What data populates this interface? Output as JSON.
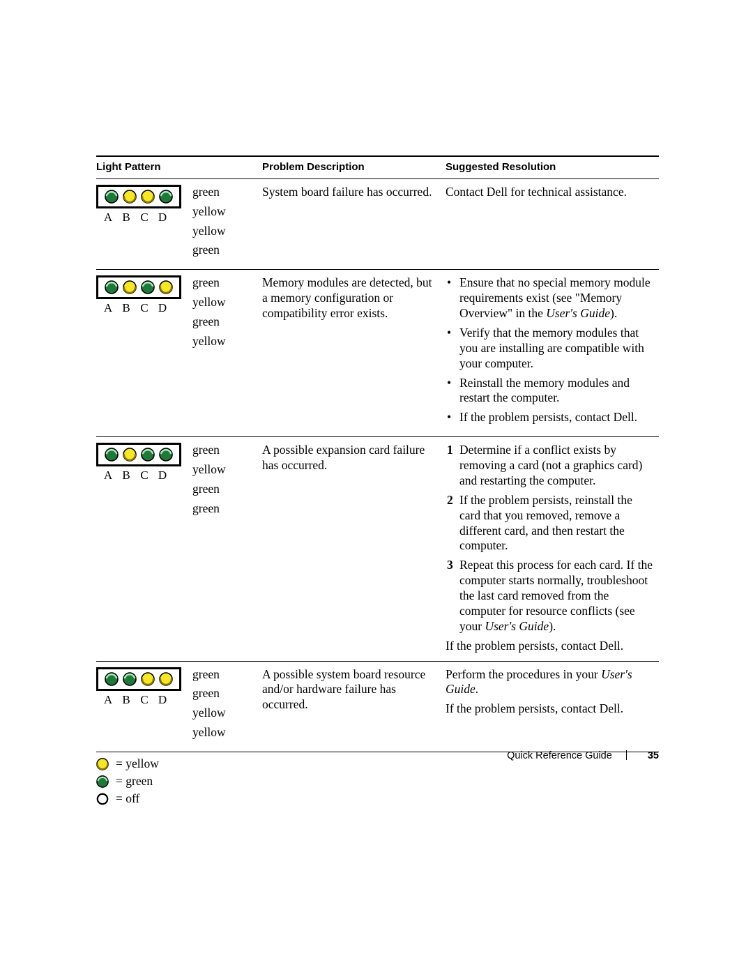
{
  "headers": {
    "light_pattern": "Light Pattern",
    "problem": "Problem Description",
    "resolution": "Suggested Resolution"
  },
  "led_labels": [
    "A",
    "B",
    "C",
    "D"
  ],
  "colors": {
    "yellow_fill": "#f6e72a",
    "yellow_stroke": "#8a7a00",
    "green_fill": "#1f7a3a",
    "green_stroke": "#0e4a22",
    "green_high": "#a6e6b8",
    "off_stroke": "#000000"
  },
  "rows": [
    {
      "leds": [
        "green",
        "yellow",
        "yellow",
        "green"
      ],
      "codes": [
        "green",
        "yellow",
        "yellow",
        "green"
      ],
      "problem": "System board failure has occurred.",
      "resolution_plain": "Contact Dell for technical assistance."
    },
    {
      "leds": [
        "green",
        "yellow",
        "green",
        "yellow"
      ],
      "codes": [
        "green",
        "yellow",
        "green",
        "yellow"
      ],
      "problem": "Memory modules are detected, but a memory configuration or compatibility error exists.",
      "resolution_bullets": [
        {
          "pre": "Ensure that no special memory module requirements exist (see \"Memory Overview\" in the ",
          "ital": "User's Guide",
          "post": ")."
        },
        {
          "pre": "Verify that the memory modules that you are installing are compatible with your computer."
        },
        {
          "pre": "Reinstall the memory modules and restart the computer."
        },
        {
          "pre": "If the problem persists, contact Dell."
        }
      ]
    },
    {
      "leds": [
        "green",
        "yellow",
        "green",
        "green"
      ],
      "codes": [
        "green",
        "yellow",
        "green",
        "green"
      ],
      "problem": "A possible expansion card failure has occurred.",
      "resolution_numbers": [
        {
          "pre": "Determine if a conflict exists by removing a card (not a graphics card) and restarting the computer."
        },
        {
          "pre": "If the problem persists, reinstall the card that you removed, remove a different card, and then restart the computer."
        },
        {
          "pre": "Repeat this process for each card. If the computer starts normally, troubleshoot the last card removed from the computer for resource conflicts (see your ",
          "ital": "User's Guide",
          "post": ")."
        }
      ],
      "resolution_trailer": "If the problem persists, contact Dell."
    },
    {
      "leds": [
        "green",
        "green",
        "yellow",
        "yellow"
      ],
      "codes": [
        "green",
        "green",
        "yellow",
        "yellow"
      ],
      "problem": "A possible system board resource and/or hardware failure has occurred.",
      "resolution_lines": [
        {
          "pre": "Perform the procedures in your ",
          "ital": "User's Guide",
          "post": "."
        },
        {
          "pre": "If the problem persists, contact Dell."
        }
      ]
    }
  ],
  "legend": [
    {
      "kind": "yellow",
      "text": "= yellow"
    },
    {
      "kind": "green",
      "text": "= green"
    },
    {
      "kind": "off",
      "text": "= off"
    }
  ],
  "footer": {
    "title": "Quick Reference Guide",
    "page": "35"
  }
}
